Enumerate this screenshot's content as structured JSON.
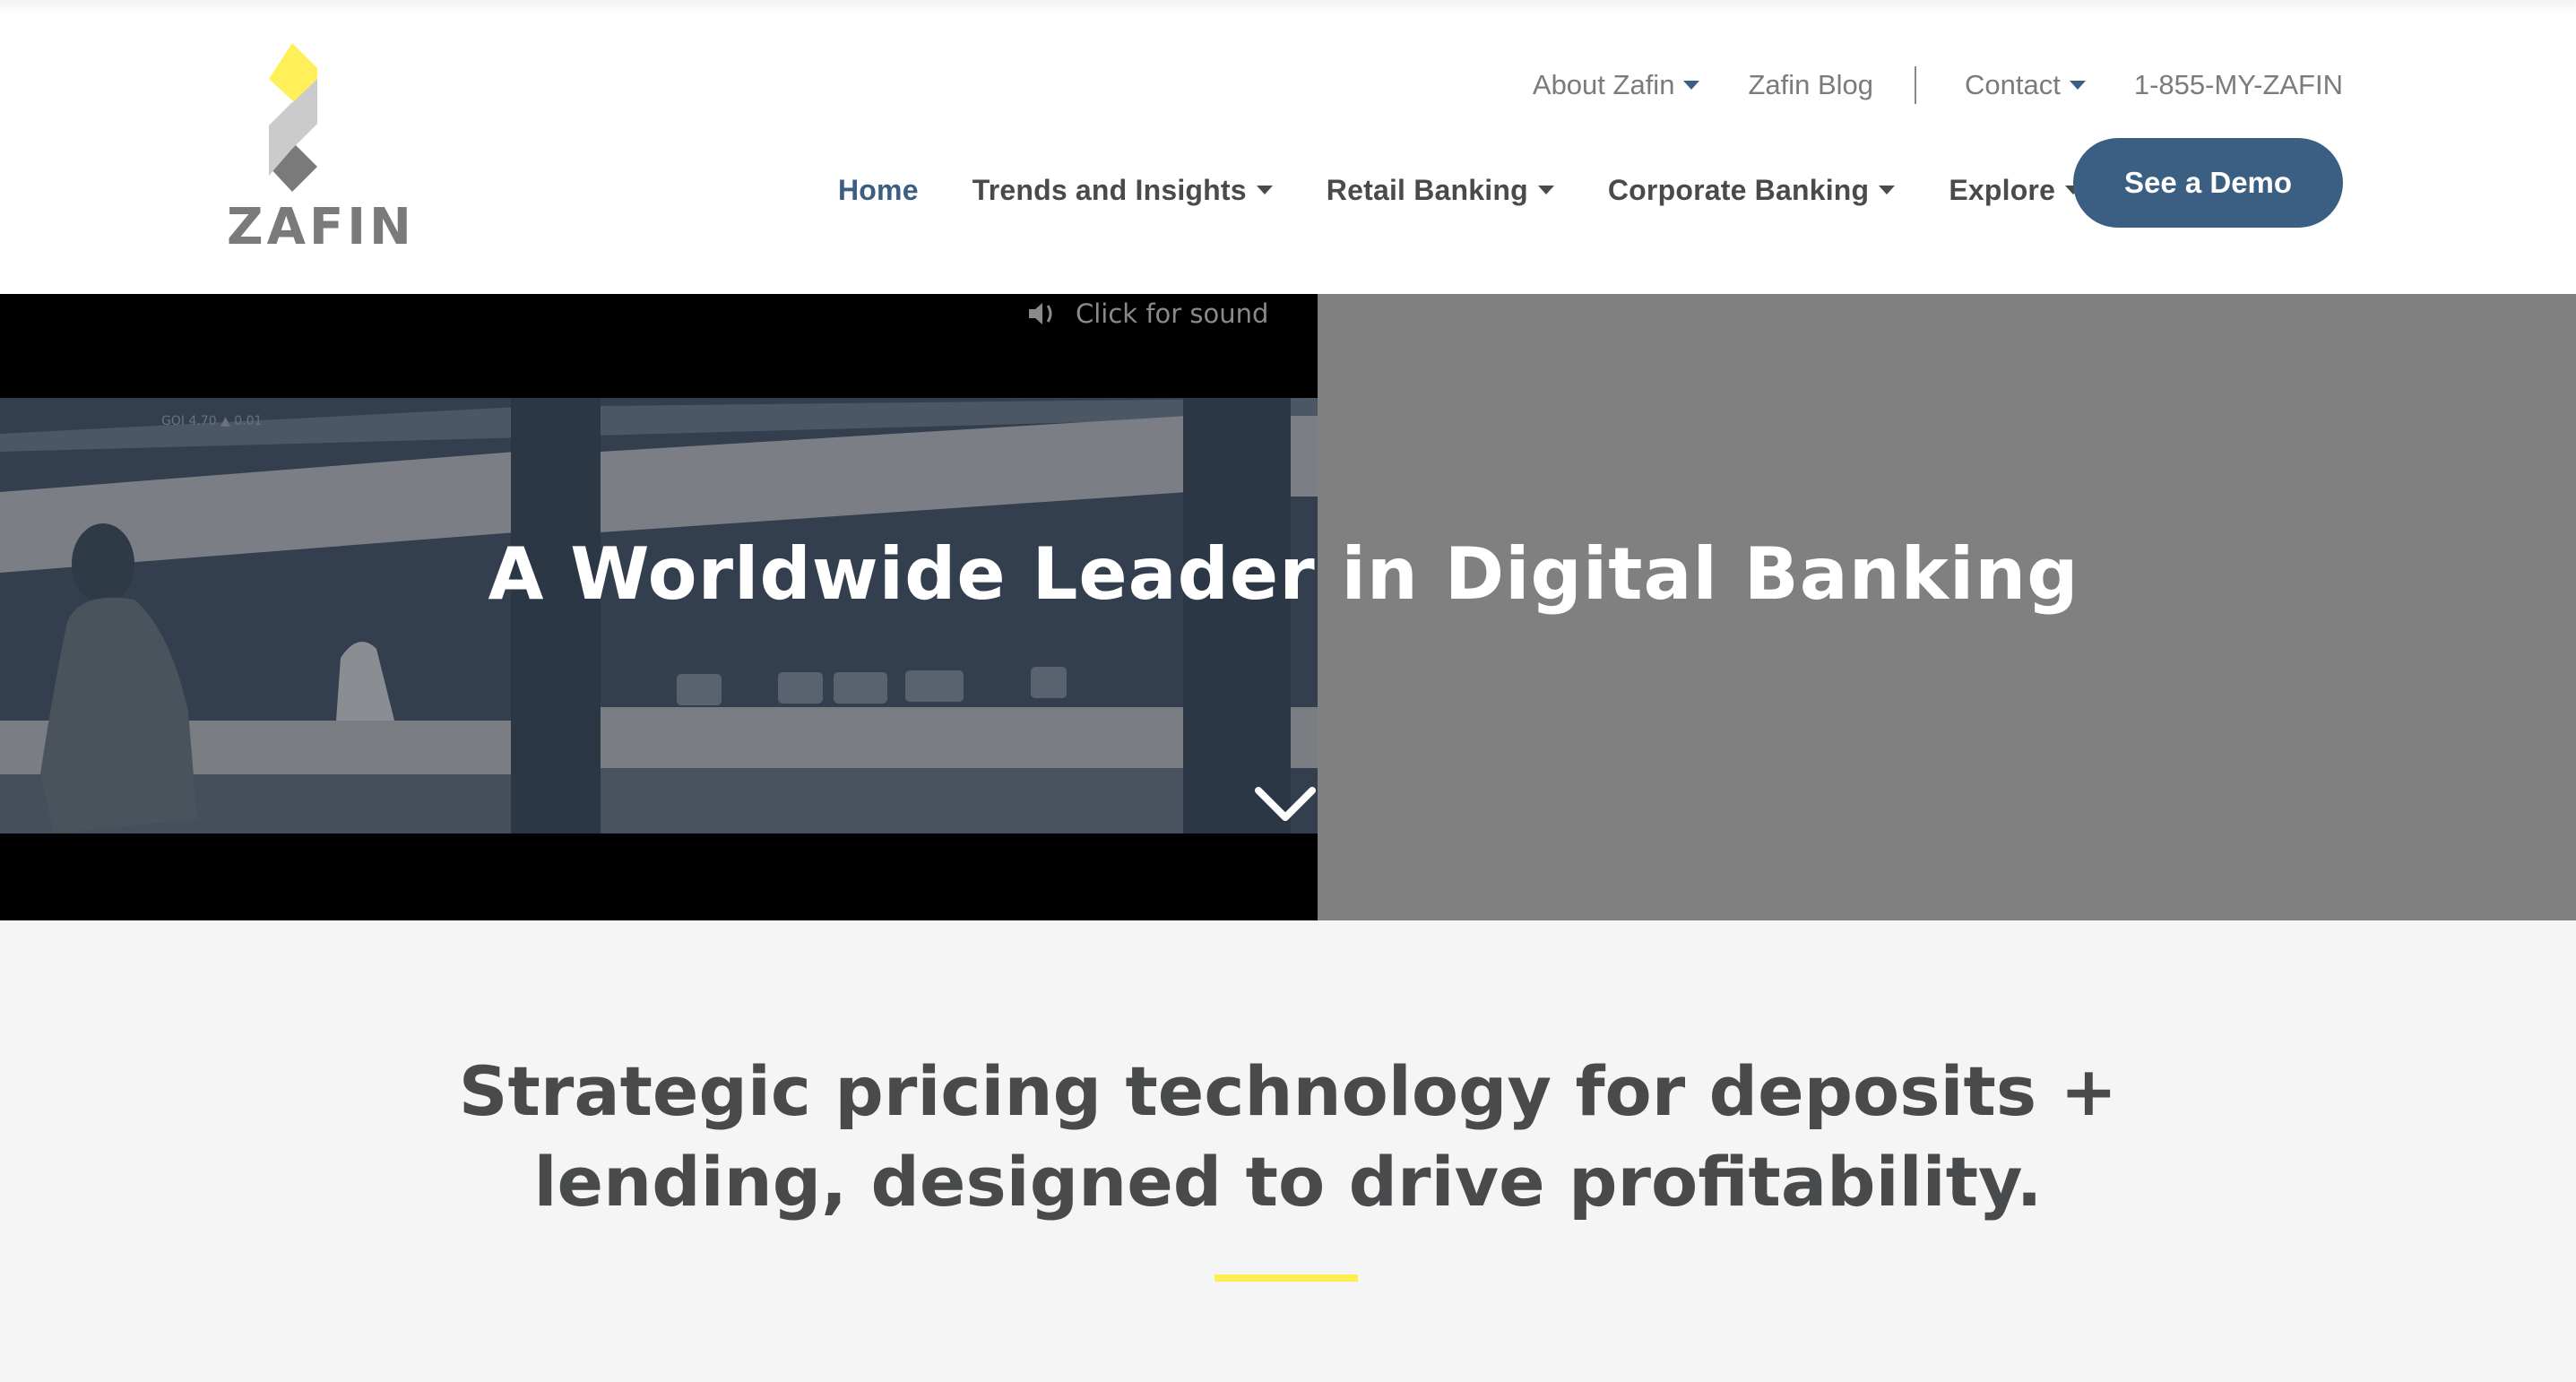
{
  "brand": {
    "name": "ZAFIN",
    "colors": {
      "primary": "#3b5f82",
      "accent_yellow": "#ffee50",
      "logo_yellow": "#fff05a",
      "logo_light_gray": "#cbcbcb",
      "logo_dark_gray": "#7a7a7a",
      "hero_gray": "#808080",
      "text_dark": "#4a4a4a"
    }
  },
  "utility_nav": {
    "items": [
      {
        "label": "About Zafin",
        "has_dropdown": true
      },
      {
        "label": "Zafin Blog",
        "has_dropdown": false
      },
      {
        "label": "Contact",
        "has_dropdown": true
      },
      {
        "label": "1-855-MY-ZAFIN",
        "has_dropdown": false
      }
    ]
  },
  "main_nav": {
    "items": [
      {
        "label": "Home",
        "active": true,
        "has_dropdown": false
      },
      {
        "label": "Trends and Insights",
        "active": false,
        "has_dropdown": true
      },
      {
        "label": "Retail Banking",
        "active": false,
        "has_dropdown": true
      },
      {
        "label": "Corporate Banking",
        "active": false,
        "has_dropdown": true
      },
      {
        "label": "Explore",
        "active": false,
        "has_dropdown": true
      }
    ],
    "cta_label": "See a Demo"
  },
  "hero": {
    "sound_label": "Click for sound",
    "sound_icon": "speaker-icon",
    "title": "A Worldwide Leader in Digital Banking",
    "scroll_icon": "chevron-down-icon",
    "video_caption_ticker": "GOI 4.70 ▲ 0.01"
  },
  "intro": {
    "headline_line1": "Strategic pricing technology for deposits +",
    "headline_line2": "lending, designed to drive profitability."
  }
}
